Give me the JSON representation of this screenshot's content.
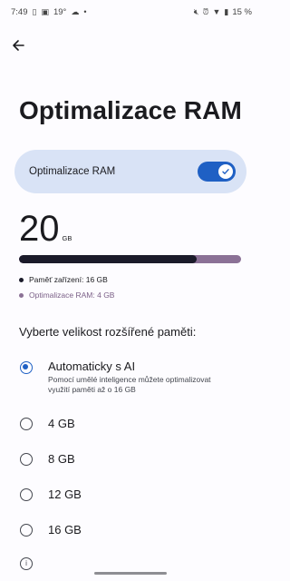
{
  "status_bar": {
    "time": "7:49",
    "temperature": "19°",
    "battery": "15 %"
  },
  "page": {
    "title": "Optimalizace RAM"
  },
  "toggle": {
    "label": "Optimalizace RAM",
    "enabled": true
  },
  "ram": {
    "total": "20",
    "unit": "GB",
    "device_fraction": 0.8
  },
  "legend": {
    "device": "Paměť zařízení: 16 GB",
    "optimized": "Optimalizace RAM: 4 GB"
  },
  "section": {
    "label": "Vyberte velikost rozšířené paměti:"
  },
  "options": [
    {
      "label": "Automaticky s AI",
      "description": "Pomocí umělé inteligence můžete optimalizovat využití paměti až o 16 GB",
      "selected": true
    },
    {
      "label": "4 GB",
      "selected": false
    },
    {
      "label": "8 GB",
      "selected": false
    },
    {
      "label": "12 GB",
      "selected": false
    },
    {
      "label": "16 GB",
      "selected": false
    }
  ],
  "colors": {
    "accent": "#1f60c4",
    "card": "#d9e3f6",
    "bar_device": "#1b1b2a",
    "bar_optimized": "#8b7196"
  }
}
